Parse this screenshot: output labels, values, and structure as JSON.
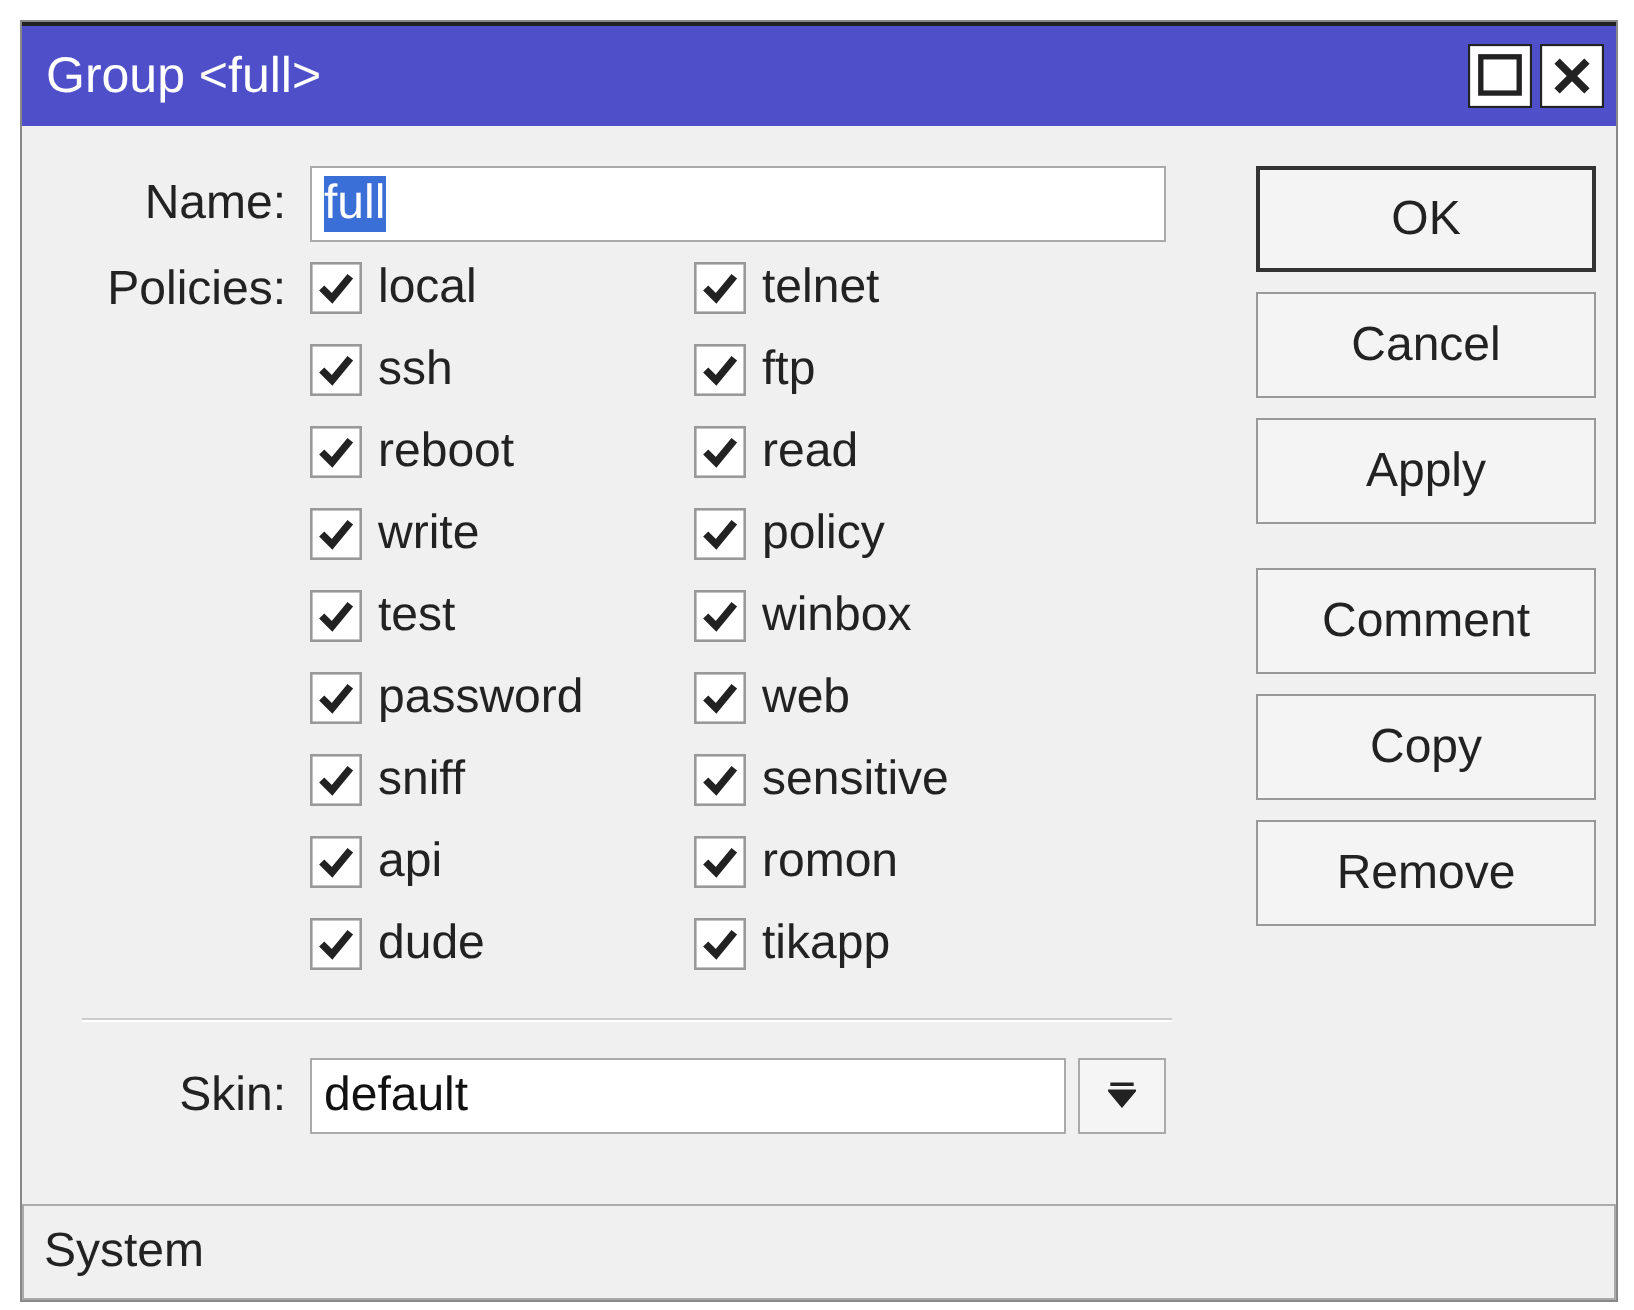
{
  "window": {
    "title": "Group <full>"
  },
  "name": {
    "label": "Name:",
    "value": "full",
    "selected": true
  },
  "policies": {
    "label": "Policies:",
    "items": [
      {
        "label": "local",
        "checked": true
      },
      {
        "label": "telnet",
        "checked": true
      },
      {
        "label": "ssh",
        "checked": true
      },
      {
        "label": "ftp",
        "checked": true
      },
      {
        "label": "reboot",
        "checked": true
      },
      {
        "label": "read",
        "checked": true
      },
      {
        "label": "write",
        "checked": true
      },
      {
        "label": "policy",
        "checked": true
      },
      {
        "label": "test",
        "checked": true
      },
      {
        "label": "winbox",
        "checked": true
      },
      {
        "label": "password",
        "checked": true
      },
      {
        "label": "web",
        "checked": true
      },
      {
        "label": "sniff",
        "checked": true
      },
      {
        "label": "sensitive",
        "checked": true
      },
      {
        "label": "api",
        "checked": true
      },
      {
        "label": "romon",
        "checked": true
      },
      {
        "label": "dude",
        "checked": true
      },
      {
        "label": "tikapp",
        "checked": true
      }
    ]
  },
  "skin": {
    "label": "Skin:",
    "value": "default"
  },
  "buttons": [
    {
      "label": "OK",
      "kind": "default"
    },
    {
      "label": "Cancel",
      "kind": "normal"
    },
    {
      "label": "Apply",
      "kind": "normal"
    },
    {
      "label": "Comment",
      "kind": "spaced"
    },
    {
      "label": "Copy",
      "kind": "normal"
    },
    {
      "label": "Remove",
      "kind": "normal"
    }
  ],
  "status_bar": "System"
}
